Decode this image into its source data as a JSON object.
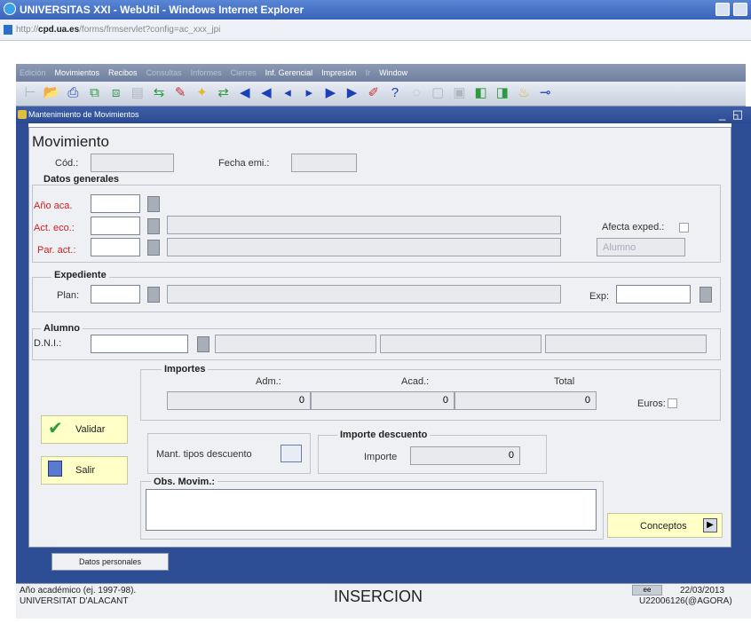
{
  "window": {
    "title": "UNIVERSITAS XXI - WebUtil - Windows Internet Explorer"
  },
  "address": {
    "prefix": "http://",
    "host": "cpd.ua.es",
    "suffix": "/forms/frmservlet?config=ac_xxx_jpi"
  },
  "menu": [
    {
      "label": "Edición",
      "enabled": false
    },
    {
      "label": "Movimientos",
      "enabled": true
    },
    {
      "label": "Recibos",
      "enabled": true
    },
    {
      "label": "Consultas",
      "enabled": false
    },
    {
      "label": "Informes",
      "enabled": false
    },
    {
      "label": "Cierres",
      "enabled": false
    },
    {
      "label": "Inf. Gerencial",
      "enabled": true
    },
    {
      "label": "Impresión",
      "enabled": true
    },
    {
      "label": "Ir",
      "enabled": false
    },
    {
      "label": "Window",
      "enabled": true
    }
  ],
  "frame": {
    "title": "Mantenimiento de Movimientos",
    "controls": "_ ◱ ✕"
  },
  "form": {
    "heading": "Movimiento",
    "cod_label": "Cód.:",
    "fecha_label": "Fecha emi.:",
    "datos_generales": "Datos generales",
    "anio_label": "Año aca.",
    "act_eco_label": "Act. eco.:",
    "par_act_label": "Par. act.:",
    "afecta_label": "Afecta exped.:",
    "alumno_select": "Alumno",
    "expediente_title": "Expediente",
    "plan_label": "Plan:",
    "exp_label": "Exp:",
    "alumno_title": "Alumno",
    "dni_label": "D.N.I.:",
    "importes_title": "Importes",
    "adm_label": "Adm.:",
    "acad_label": "Acad.:",
    "total_label": "Total",
    "adm_value": "0",
    "acad_value": "0",
    "total_value": "0",
    "euros_label": "Euros:",
    "validar": "Validar",
    "salir": "Salir",
    "mant_label": "Mant. tipos descuento",
    "importe_desc_title": "Importe descuento",
    "importe_label": "Importe",
    "importe_value": "0",
    "obs_label": "Obs. Movim.:",
    "conceptos": "Conceptos",
    "datos_personales": "Datos personales"
  },
  "status": {
    "hint_line1": "Año académico (ej. 1997-98).",
    "hint_line2": "UNIVERSITAT D'ALACANT",
    "mode": "INSERCION",
    "indicator": "ee",
    "date": "22/03/2013",
    "user": "U22006126(@AGORA)"
  }
}
